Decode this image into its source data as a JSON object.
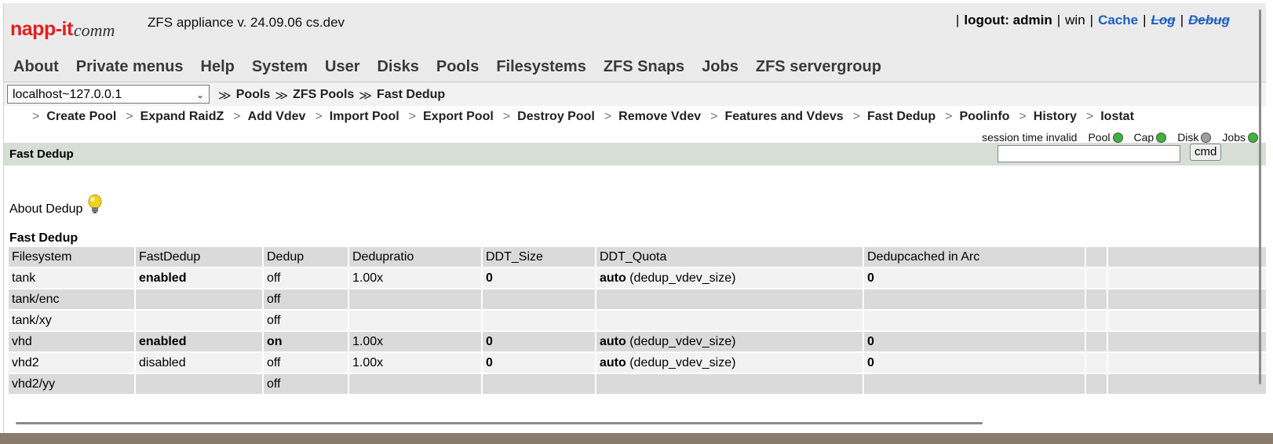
{
  "app": {
    "logo_text": "napp-it",
    "logo_sub": "comm",
    "title": "ZFS appliance v. 24.09.06 cs.dev"
  },
  "userbar": {
    "logout_label": "logout: admin",
    "win": "win",
    "cache": "Cache",
    "log": "Log",
    "debug": "Debug"
  },
  "mainnav": [
    "About",
    "Private menus",
    "Help",
    "System",
    "User",
    "Disks",
    "Pools",
    "Filesystems",
    "ZFS Snaps",
    "Jobs",
    "ZFS servergroup"
  ],
  "host_select": {
    "value": "localhost~127.0.0.1"
  },
  "breadcrumb": [
    "Pools",
    "ZFS Pools",
    "Fast Dedup"
  ],
  "subnav": [
    "Create Pool",
    "Expand RaidZ",
    "Add Vdev",
    "Import Pool",
    "Export Pool",
    "Destroy Pool",
    "Remove Vdev",
    "Features and Vdevs",
    "Fast Dedup",
    "Poolinfo",
    "History",
    "Iostat"
  ],
  "status": {
    "session": "session time invalid",
    "indicators": [
      {
        "label": "Pool",
        "color": "#3cb43c"
      },
      {
        "label": "Cap",
        "color": "#3cb43c"
      },
      {
        "label": "Disk",
        "color": "#a0a0a0"
      },
      {
        "label": "Jobs",
        "color": "#3cb43c"
      }
    ]
  },
  "page_title": "Fast Dedup",
  "cmd": {
    "button": "cmd",
    "value": ""
  },
  "about_label": "About Dedup",
  "table": {
    "title": "Fast Dedup",
    "headers": [
      "Filesystem",
      "FastDedup",
      "Dedup",
      "Dedupratio",
      "DDT_Size",
      "DDT_Quota",
      "Dedupcached in Arc",
      "",
      ""
    ],
    "rows": [
      {
        "fs": "tank",
        "fast": "enabled",
        "fast_bold": true,
        "dedup": "off",
        "dedup_bold": false,
        "ratio": "1.00x",
        "ddt": "0",
        "quota_bold": "auto",
        "quota_rest": " (dedup_vdev_size)",
        "arc": "0"
      },
      {
        "fs": "tank/enc",
        "fast": "",
        "fast_bold": false,
        "dedup": "off",
        "dedup_bold": false,
        "ratio": "",
        "ddt": "",
        "quota_bold": "",
        "quota_rest": "",
        "arc": ""
      },
      {
        "fs": "tank/xy",
        "fast": "",
        "fast_bold": false,
        "dedup": "off",
        "dedup_bold": false,
        "ratio": "",
        "ddt": "",
        "quota_bold": "",
        "quota_rest": "",
        "arc": ""
      },
      {
        "fs": "vhd",
        "fast": "enabled",
        "fast_bold": true,
        "dedup": "on",
        "dedup_bold": true,
        "ratio": "1.00x",
        "ddt": "0",
        "quota_bold": "auto",
        "quota_rest": " (dedup_vdev_size)",
        "arc": "0"
      },
      {
        "fs": "vhd2",
        "fast": "disabled",
        "fast_bold": false,
        "dedup": "off",
        "dedup_bold": false,
        "ratio": "1.00x",
        "ddt": "0",
        "quota_bold": "auto",
        "quota_rest": " (dedup_vdev_size)",
        "arc": "0"
      },
      {
        "fs": "vhd2/yy",
        "fast": "",
        "fast_bold": false,
        "dedup": "off",
        "dedup_bold": false,
        "ratio": "",
        "ddt": "",
        "quota_bold": "",
        "quota_rest": "",
        "arc": ""
      }
    ]
  }
}
